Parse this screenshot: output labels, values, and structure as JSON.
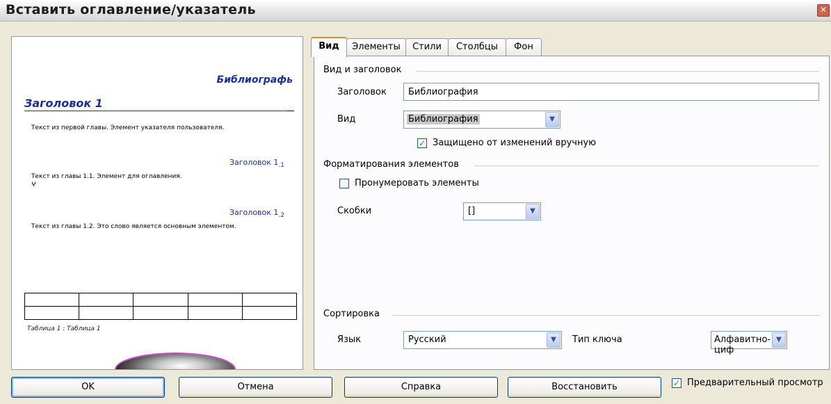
{
  "window": {
    "title": "Вставить оглавление/указатель",
    "close": "✕"
  },
  "preview": {
    "title": "Библиографь",
    "heading1": "Заголовок 1",
    "text1": "Текст из первой главы. Элемент указателя пользователя.",
    "heading_1_1": "Заголовок 1",
    "heading_1_1_sub": ".1",
    "text2": "Текст из главы 1.1. Элемент для оглавления.",
    "text2_mark": "ⵖ",
    "heading_1_2": "Заголовок 1",
    "heading_1_2_sub": ".2",
    "text3": "Текст из главы 1.2. Это слово является основным элементом.",
    "table_caption": "Таблица 1 : Таблица 1"
  },
  "tabs": [
    {
      "label": "Вид",
      "active": true
    },
    {
      "label": "Элементы",
      "active": false
    },
    {
      "label": "Стили",
      "active": false
    },
    {
      "label": "Столбцы",
      "active": false
    },
    {
      "label": "Фон",
      "active": false
    }
  ],
  "type_and_title": {
    "section": "Вид и заголовок",
    "title_label": "Заголовок",
    "title_value": "Библиография",
    "type_label": "Вид",
    "type_value": "Библиография",
    "protected_label": "Защищено от изменений вручную",
    "protected_checked": true
  },
  "formatting": {
    "section": "Форматирования элементов",
    "number_label": "Пронумеровать элементы",
    "number_checked": false,
    "brackets_label": "Скобки",
    "brackets_value": "[]"
  },
  "sort": {
    "section": "Сортировка",
    "language_label": "Язык",
    "language_value": "Русский",
    "key_type_label": "Тип ключа",
    "key_type_value": "Алфавитно-циф"
  },
  "buttons": {
    "ok": "OK",
    "cancel": "Отмена",
    "help": "Справка",
    "reset": "Восстановить",
    "preview_label": "Предварительный просмотр",
    "preview_checked": true
  },
  "colors": {
    "preview_heading": "#1a2ea0",
    "check": "#21a121",
    "tab_highlight": "#e68b2c"
  }
}
